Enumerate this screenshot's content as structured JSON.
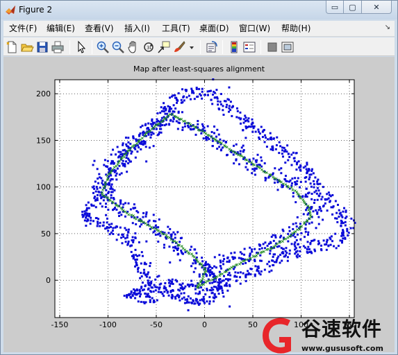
{
  "window": {
    "title": "Figure 2",
    "minimize_glyph": "▭",
    "maximize_glyph": "▢",
    "close_glyph": "✕"
  },
  "menu": {
    "items": [
      "文件(F)",
      "编辑(E)",
      "查看(V)",
      "插入(I)",
      "工具(T)",
      "桌面(D)",
      "窗口(W)",
      "帮助(H)"
    ],
    "overflow_glyph": "↘"
  },
  "toolbar": {
    "icons": [
      "new-figure-icon",
      "open-file-icon",
      "save-icon",
      "print-icon",
      "edit-plot-arrow-icon",
      "zoom-in-icon",
      "zoom-out-icon",
      "pan-hand-icon",
      "rotate-3d-icon",
      "data-cursor-icon",
      "brush-icon",
      "brush-dropdown-icon",
      "link-plot-icon",
      "colorbar-icon",
      "legend-icon",
      "hide-plot-tools-icon",
      "show-plot-tools-icon"
    ]
  },
  "colors": {
    "scan_points": "#0b0bd9",
    "trajectory": "#1f8a1f",
    "watermark_red": "#e8262a",
    "figure_background": "#cccccc"
  },
  "chart_data": {
    "type": "scatter",
    "title": "Map after least-squares alignment",
    "xlabel": "",
    "ylabel": "",
    "xlim": [
      -155,
      155
    ],
    "ylim": [
      -40,
      215
    ],
    "xticks": [
      -150,
      -100,
      -50,
      0,
      50,
      100,
      150
    ],
    "yticks": [
      0,
      50,
      100,
      150,
      200
    ],
    "grid": true,
    "grid_style": "dotted",
    "series": [
      {
        "marker": "blue dots",
        "polyline": [
          [
            -35,
            178
          ],
          [
            -60,
            160
          ],
          [
            -90,
            130
          ],
          [
            -108,
            110
          ],
          [
            -105,
            92
          ],
          [
            -75,
            72
          ],
          [
            -30,
            42
          ],
          [
            0,
            12
          ],
          [
            55,
            30
          ],
          [
            95,
            50
          ],
          [
            115,
            70
          ],
          [
            110,
            82
          ],
          [
            95,
            100
          ],
          [
            55,
            122
          ],
          [
            25,
            143
          ],
          [
            -10,
            165
          ],
          [
            -35,
            178
          ]
        ],
        "spread": 9
      },
      {
        "marker": "blue dots",
        "polyline": [
          [
            -125,
            65
          ],
          [
            -108,
            92
          ],
          [
            -90,
            118
          ],
          [
            -75,
            140
          ],
          [
            -60,
            152
          ],
          [
            -35,
            188
          ],
          [
            -15,
            200
          ],
          [
            5,
            200
          ],
          [
            30,
            180
          ],
          [
            55,
            160
          ],
          [
            80,
            140
          ],
          [
            105,
            120
          ],
          [
            118,
            100
          ],
          [
            128,
            85
          ],
          [
            140,
            70
          ],
          [
            150,
            55
          ],
          [
            145,
            45
          ],
          [
            120,
            38
          ],
          [
            95,
            32
          ],
          [
            70,
            20
          ],
          [
            40,
            5
          ],
          [
            0,
            -8
          ],
          [
            -40,
            -5
          ],
          [
            -60,
            0
          ],
          [
            -70,
            25
          ],
          [
            -75,
            45
          ],
          [
            -110,
            65
          ],
          [
            -125,
            65
          ]
        ],
        "spread": 7
      },
      {
        "marker": "blue dots",
        "polyline": [
          [
            0,
            15
          ],
          [
            20,
            -10
          ],
          [
            -5,
            -25
          ],
          [
            -30,
            -15
          ],
          [
            -60,
            -10
          ],
          [
            -80,
            -15
          ],
          [
            -50,
            -22
          ]
        ],
        "spread": 5
      },
      {
        "marker": "green x",
        "polyline": [
          [
            -35,
            178
          ],
          [
            -55,
            162
          ],
          [
            -80,
            138
          ],
          [
            -100,
            112
          ],
          [
            -106,
            92
          ],
          [
            -80,
            72
          ],
          [
            -40,
            48
          ],
          [
            -10,
            25
          ],
          [
            2,
            10
          ],
          [
            -8,
            -8
          ],
          [
            15,
            5
          ],
          [
            40,
            20
          ],
          [
            70,
            35
          ],
          [
            95,
            52
          ],
          [
            110,
            68
          ],
          [
            108,
            78
          ],
          [
            95,
            95
          ],
          [
            65,
            115
          ],
          [
            35,
            135
          ],
          [
            5,
            155
          ],
          [
            -20,
            170
          ],
          [
            -35,
            178
          ]
        ]
      }
    ]
  },
  "watermark": {
    "name": "谷速软件",
    "url": "www.gususoft.com"
  }
}
